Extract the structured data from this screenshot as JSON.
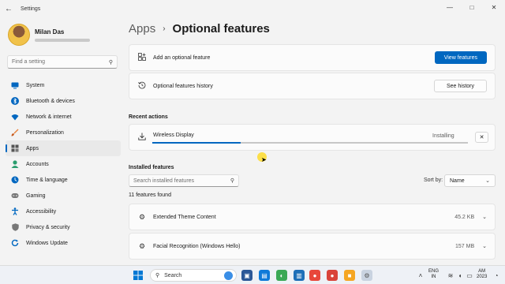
{
  "window": {
    "title": "Settings",
    "back_glyph": "←",
    "controls": [
      "—",
      "□",
      "✕"
    ]
  },
  "profile": {
    "name": "Milan Das"
  },
  "search": {
    "placeholder": "Find a setting"
  },
  "sidebar": {
    "items": [
      {
        "label": "System",
        "icon": "monitor-icon",
        "color": "#0067c0",
        "active": false
      },
      {
        "label": "Bluetooth & devices",
        "icon": "bluetooth-icon",
        "color": "#0067c0",
        "active": false
      },
      {
        "label": "Network & internet",
        "icon": "wifi-icon",
        "color": "#0067c0",
        "active": false
      },
      {
        "label": "Personalization",
        "icon": "brush-icon",
        "color": "#e8813a",
        "active": false
      },
      {
        "label": "Apps",
        "icon": "apps-icon",
        "color": "#555555",
        "active": true
      },
      {
        "label": "Accounts",
        "icon": "person-icon",
        "color": "#2a9d6e",
        "active": false
      },
      {
        "label": "Time & language",
        "icon": "globe-icon",
        "color": "#0067c0",
        "active": false
      },
      {
        "label": "Gaming",
        "icon": "gamepad-icon",
        "color": "#777777",
        "active": false
      },
      {
        "label": "Accessibility",
        "icon": "accessibility-icon",
        "color": "#0067c0",
        "active": false
      },
      {
        "label": "Privacy & security",
        "icon": "shield-icon",
        "color": "#777777",
        "active": false
      },
      {
        "label": "Windows Update",
        "icon": "update-icon",
        "color": "#0067c0",
        "active": false
      }
    ]
  },
  "breadcrumb": {
    "root": "Apps",
    "separator": "›",
    "page": "Optional features"
  },
  "add_feature": {
    "label": "Add an optional feature",
    "button": "View features"
  },
  "history": {
    "label": "Optional features history",
    "button": "See history"
  },
  "recent": {
    "title": "Recent actions",
    "item": {
      "name": "Wireless Display",
      "status": "Installing",
      "progress": 0.28
    }
  },
  "installed": {
    "title": "Installed features",
    "search_placeholder": "Search installed features",
    "sort_label": "Sort by:",
    "sort_value": "Name",
    "count": "11 features found",
    "features": [
      {
        "name": "Extended Theme Content",
        "size": "45.2 KB"
      },
      {
        "name": "Facial Recognition (Windows Hello)",
        "size": "157 MB"
      }
    ]
  },
  "taskbar": {
    "search_placeholder": "Search",
    "language": {
      "line1": "ENG",
      "line2": "IN"
    },
    "clock": {
      "line1": "AM",
      "line2": "2023"
    }
  },
  "colors": {
    "accent": "#0067c0",
    "cursor_highlight": "#ffd600"
  }
}
